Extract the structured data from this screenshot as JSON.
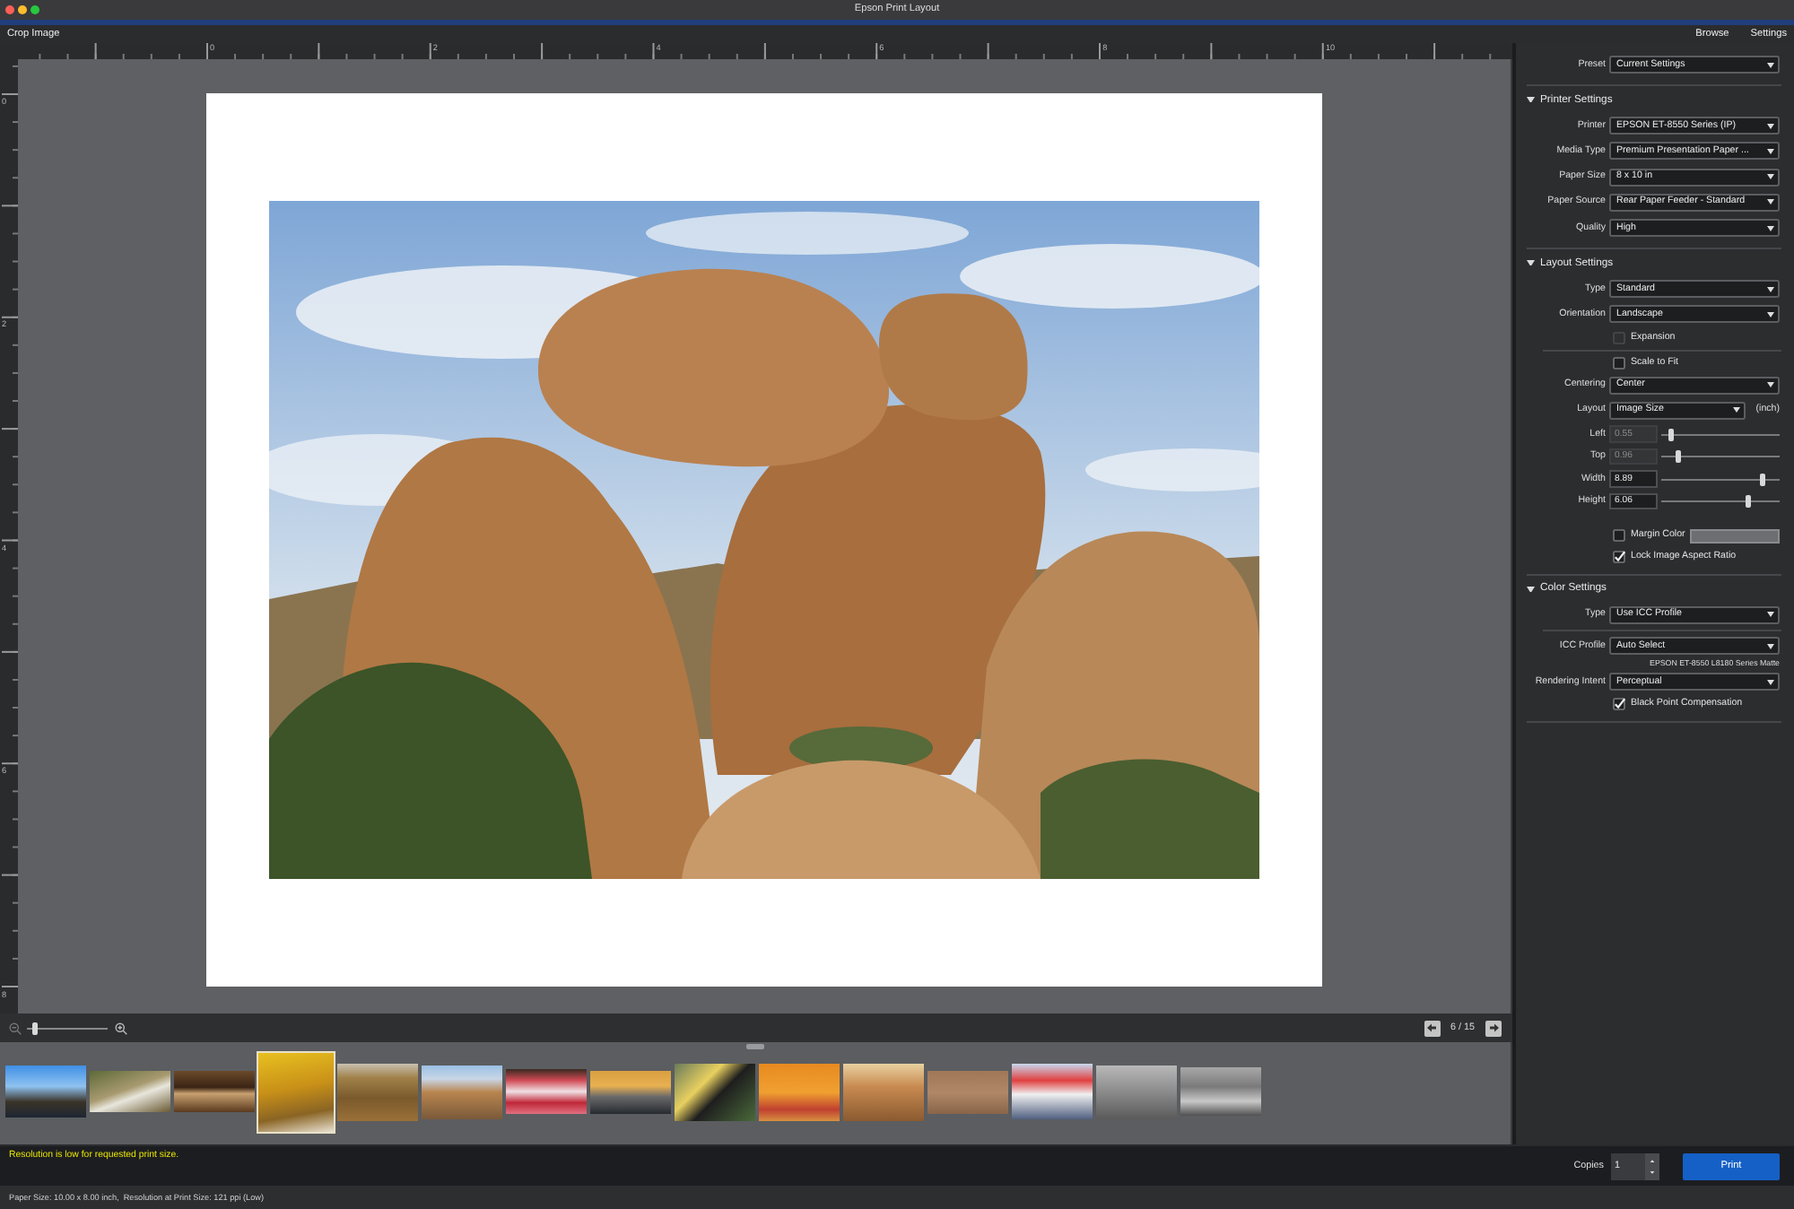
{
  "window": {
    "title": "Epson Print Layout"
  },
  "toolbar": {
    "left": [
      "Crop Image"
    ],
    "right": [
      "Browse",
      "Settings"
    ]
  },
  "rulers": {
    "horizontal": [
      "0",
      "2",
      "4",
      "6",
      "8",
      "10"
    ],
    "vertical": [
      "0",
      "2",
      "4",
      "6",
      "8"
    ]
  },
  "zoom": {
    "level": 0.06
  },
  "pager": {
    "text": "6 / 15"
  },
  "filmstrip": {
    "thumbnails": [
      {
        "enlarged": false
      },
      {
        "enlarged": false
      },
      {
        "enlarged": false
      },
      {
        "enlarged": true
      },
      {
        "enlarged": false
      },
      {
        "enlarged": false
      },
      {
        "enlarged": false
      },
      {
        "enlarged": false
      },
      {
        "enlarged": false
      },
      {
        "enlarged": false
      },
      {
        "enlarged": false
      },
      {
        "enlarged": false
      },
      {
        "enlarged": false
      },
      {
        "enlarged": false
      },
      {
        "enlarged": false
      }
    ]
  },
  "settings": {
    "preset": {
      "label": "Preset",
      "value": "Current Settings"
    },
    "sections": [
      {
        "title": "Printer Settings",
        "expanded": true,
        "groups": [
          {
            "rows": [
              {
                "kind": "dropdown",
                "label": "Printer",
                "value": "EPSON ET-8550 Series (IP)",
                "disabled": false
              },
              {
                "kind": "dropdown",
                "label": "Media Type",
                "value": "Premium Presentation Paper ...",
                "disabled": false
              },
              {
                "kind": "dropdown",
                "label": "Paper Size",
                "value": "8 x 10 in",
                "disabled": false
              },
              {
                "kind": "dropdown",
                "label": "Paper Source",
                "value": "Rear Paper Feeder - Standard",
                "disabled": false
              },
              {
                "kind": "dropdown",
                "label": "Quality",
                "value": "High",
                "disabled": false
              }
            ]
          }
        ]
      },
      {
        "title": "Layout Settings",
        "expanded": true,
        "groups": [
          {
            "rows": [
              {
                "kind": "dropdown",
                "label": "Type",
                "value": "Standard",
                "disabled": false
              },
              {
                "kind": "dropdown",
                "label": "Orientation",
                "value": "Landscape",
                "disabled": false
              },
              {
                "kind": "checkbox",
                "label": "Expansion",
                "checked": false,
                "disabled": true
              }
            ]
          },
          {
            "rows": [
              {
                "kind": "checkbox",
                "label": "Scale to Fit",
                "checked": false,
                "disabled": false
              },
              {
                "kind": "dropdown",
                "label": "Centering",
                "value": "Center",
                "disabled": false
              },
              {
                "kind": "dropdown",
                "label": "Layout",
                "value": "Image Size",
                "unit": "(inch)",
                "disabled": false
              },
              {
                "kind": "slider",
                "label": "Left",
                "value": "0.55",
                "disabled": true,
                "level": 0.07
              },
              {
                "kind": "slider",
                "label": "Top",
                "value": "0.96",
                "disabled": true,
                "level": 0.13
              },
              {
                "kind": "slider",
                "label": "Width",
                "value": "8.89",
                "disabled": false,
                "level": 0.88
              },
              {
                "kind": "slider",
                "label": "Height",
                "value": "6.06",
                "disabled": false,
                "level": 0.75
              },
              {
                "kind": "swatch",
                "label": "Margin Color",
                "checked": false,
                "disabled": false
              },
              {
                "kind": "checkbox",
                "label": "Lock Image Aspect Ratio",
                "checked": true,
                "disabled": false
              }
            ]
          }
        ]
      },
      {
        "title": "Color Settings",
        "expanded": true,
        "groups": [
          {
            "rows": [
              {
                "kind": "dropdown",
                "label": "Type",
                "value": "Use ICC Profile",
                "disabled": false
              }
            ]
          },
          {
            "rows": [
              {
                "kind": "dropdown",
                "label": "ICC Profile",
                "value": "Auto Select",
                "note": "EPSON ET-8550 L8180 Series Matte",
                "disabled": false
              },
              {
                "kind": "dropdown",
                "label": "Rendering Intent",
                "value": "Perceptual",
                "disabled": false
              },
              {
                "kind": "checkbox",
                "label": "Black Point Compensation",
                "checked": true,
                "disabled": false
              }
            ]
          }
        ]
      }
    ]
  },
  "print_bar": {
    "warning": "Resolution is low for requested print size.",
    "copies": {
      "label": "Copies",
      "value": "1"
    },
    "print_button": "Print"
  },
  "status_bar": {
    "text": "Paper Size: 10.00 x 8.00 inch,  Resolution at Print Size: 121 ppi (Low)"
  }
}
